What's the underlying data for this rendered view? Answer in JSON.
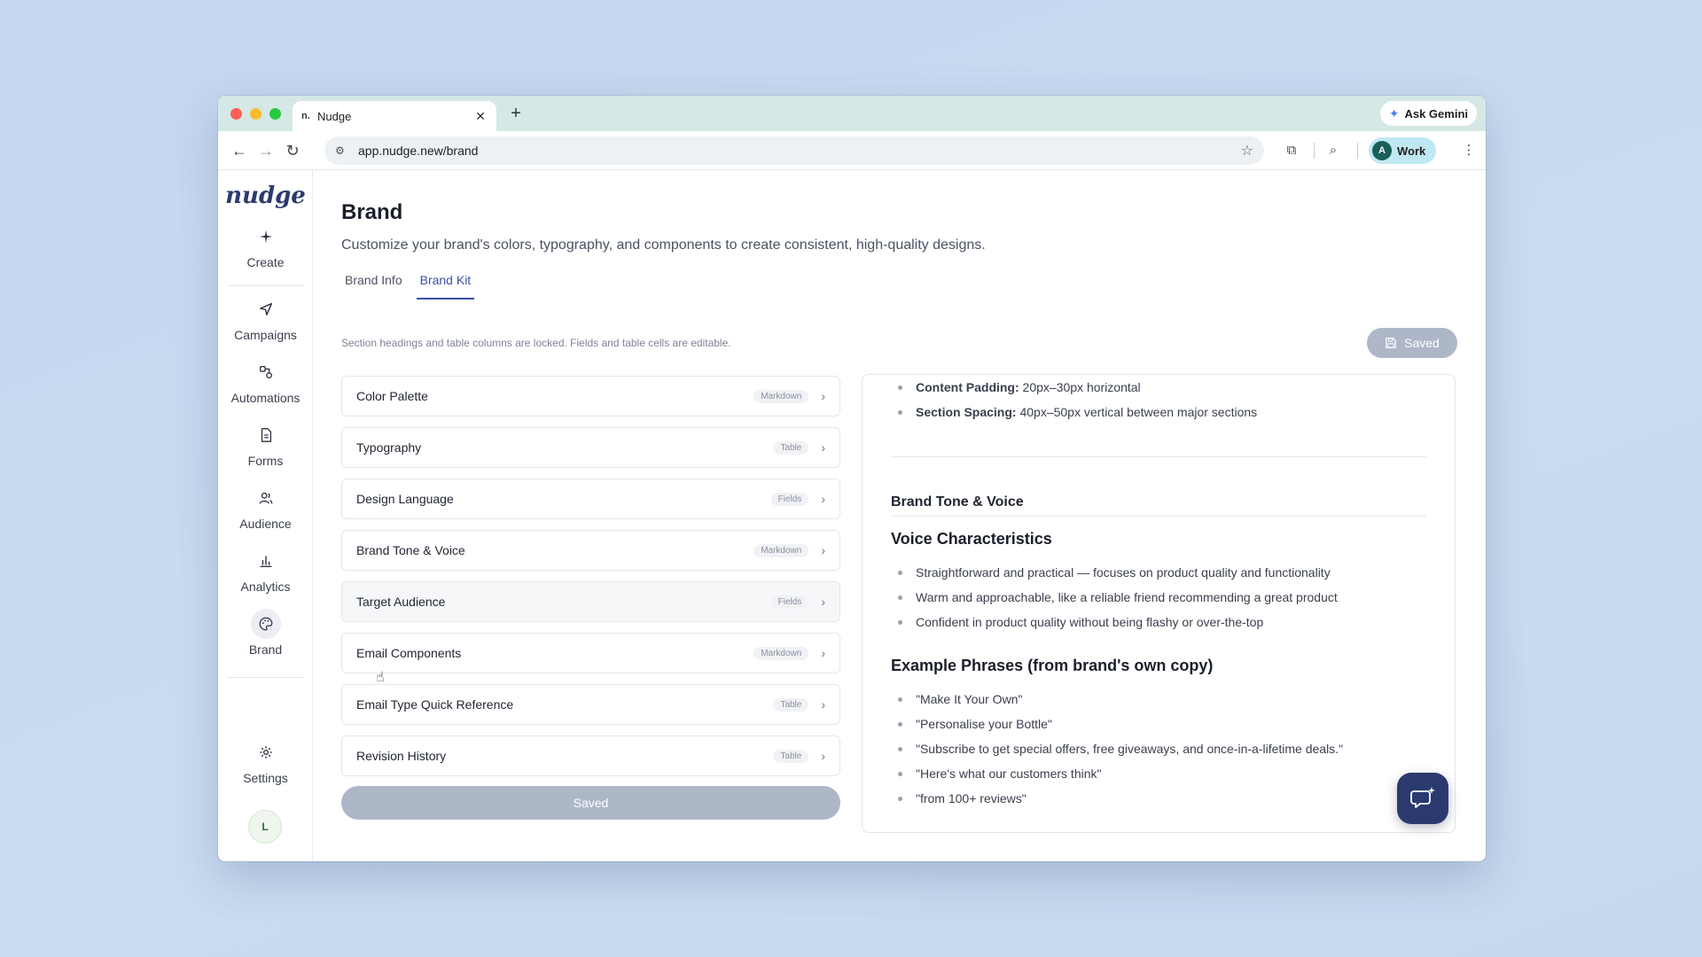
{
  "browser": {
    "tab_title": "Nudge",
    "tab_favicon": "n.",
    "url": "app.nudge.new/brand",
    "gemini_label": "Ask Gemini",
    "profile_initial": "A",
    "profile_label": "Work"
  },
  "sidebar": {
    "logo": "nudge",
    "items": [
      {
        "label": "Create",
        "icon": "plus-icon"
      },
      {
        "label": "Campaigns",
        "icon": "send-icon"
      },
      {
        "label": "Automations",
        "icon": "automation-icon"
      },
      {
        "label": "Forms",
        "icon": "document-icon"
      },
      {
        "label": "Audience",
        "icon": "users-icon"
      },
      {
        "label": "Analytics",
        "icon": "bar-chart-icon"
      },
      {
        "label": "Brand",
        "icon": "palette-icon"
      }
    ],
    "settings_label": "Settings",
    "user_initial": "L"
  },
  "page": {
    "title": "Brand",
    "subtitle": "Customize your brand's colors, typography, and components to create consistent, high-quality designs.",
    "tabs": [
      "Brand Info",
      "Brand Kit"
    ],
    "active_tab": "Brand Kit",
    "hint": "Section headings and table columns are locked. Fields and table cells are editable.",
    "saved_top": "Saved",
    "saved_bottom": "Saved"
  },
  "sections": [
    {
      "name": "Color Palette",
      "badge": "Markdown"
    },
    {
      "name": "Typography",
      "badge": "Table"
    },
    {
      "name": "Design Language",
      "badge": "Fields"
    },
    {
      "name": "Brand Tone & Voice",
      "badge": "Markdown"
    },
    {
      "name": "Target Audience",
      "badge": "Fields"
    },
    {
      "name": "Email Components",
      "badge": "Markdown"
    },
    {
      "name": "Email Type Quick Reference",
      "badge": "Table"
    },
    {
      "name": "Revision History",
      "badge": "Table"
    }
  ],
  "preview": {
    "spacing": [
      {
        "label": "Content Padding:",
        "value": " 20px–30px horizontal"
      },
      {
        "label": "Section Spacing:",
        "value": " 40px–50px vertical between major sections"
      }
    ],
    "section_heading": "Brand Tone & Voice",
    "voice_heading": "Voice Characteristics",
    "voice_items": [
      "Straightforward and practical — focuses on product quality and functionality",
      "Warm and approachable, like a reliable friend recommending a great product",
      "Confident in product quality without being flashy or over-the-top"
    ],
    "phrases_heading": "Example Phrases (from brand's own copy)",
    "phrases": [
      "\"Make It Your Own\"",
      "\"Personalise your Bottle\"",
      "\"Subscribe to get special offers, free giveaways, and once-in-a-lifetime deals.\"",
      "\"Here's what our customers think\"",
      "\"from 100+ reviews\""
    ]
  },
  "colors": {
    "accent": "#3b4fa8",
    "brand_dark": "#2b3a6e",
    "saved_button": "#aeb7c8"
  }
}
